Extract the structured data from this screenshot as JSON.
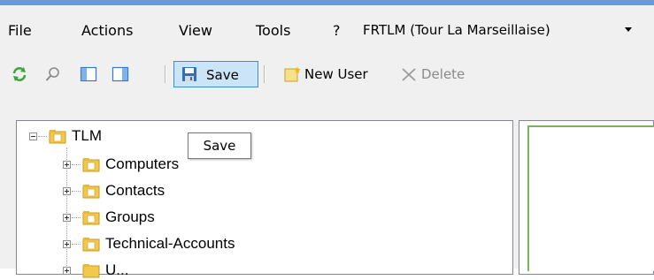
{
  "menubar": {
    "items": [
      {
        "label": "File"
      },
      {
        "label": "Actions"
      },
      {
        "label": "View"
      },
      {
        "label": "Tools"
      },
      {
        "label": "?"
      }
    ],
    "site_select": {
      "value": "FRTLM (Tour La Marseillaise)"
    }
  },
  "toolbar": {
    "refresh_icon": "refresh-icon",
    "search_icon": "magnifier-icon",
    "save_label": "Save",
    "new_user_label": "New User",
    "delete_label": "Delete"
  },
  "tooltip": {
    "text": "Save"
  },
  "tree": {
    "root": {
      "label": "TLM"
    },
    "children": [
      {
        "label": "Computers"
      },
      {
        "label": "Contacts"
      },
      {
        "label": "Groups"
      },
      {
        "label": "Technical-Accounts"
      },
      {
        "label": "U..."
      }
    ]
  },
  "colors": {
    "accent_border": "#3c8ee0",
    "save_highlight": "#cce4f7",
    "panel_green": "#77b55a",
    "folder_yellow": "#f2c94c"
  }
}
